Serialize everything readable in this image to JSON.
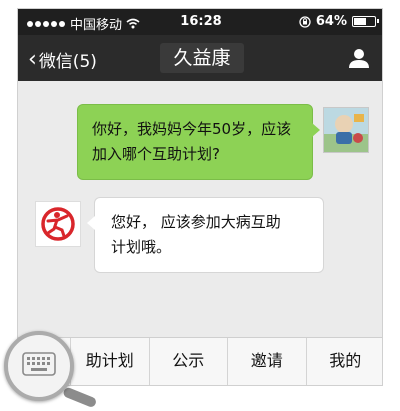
{
  "status_bar": {
    "carrier": "中国移动",
    "time": "16:28",
    "battery_percent": "64%",
    "battery_level": 0.64
  },
  "nav": {
    "back_label": "微信(5)",
    "title": "久益康"
  },
  "messages": [
    {
      "from": "self",
      "text_line1": "你好，我妈妈今年50岁，应该",
      "text_line2": "加入哪个互助计划?"
    },
    {
      "from": "bot",
      "text_line1": "您好， 应该参加大病互助",
      "text_line2": "计划哦。"
    }
  ],
  "bottom_menu": {
    "items": [
      "助计划",
      "公示",
      "邀请",
      "我的"
    ]
  },
  "colors": {
    "outgoing_bubble": "#8dd255",
    "nav_bar": "#2b2b2b",
    "status_bar": "#1f1f1f",
    "bot_logo": "#d9262b"
  }
}
